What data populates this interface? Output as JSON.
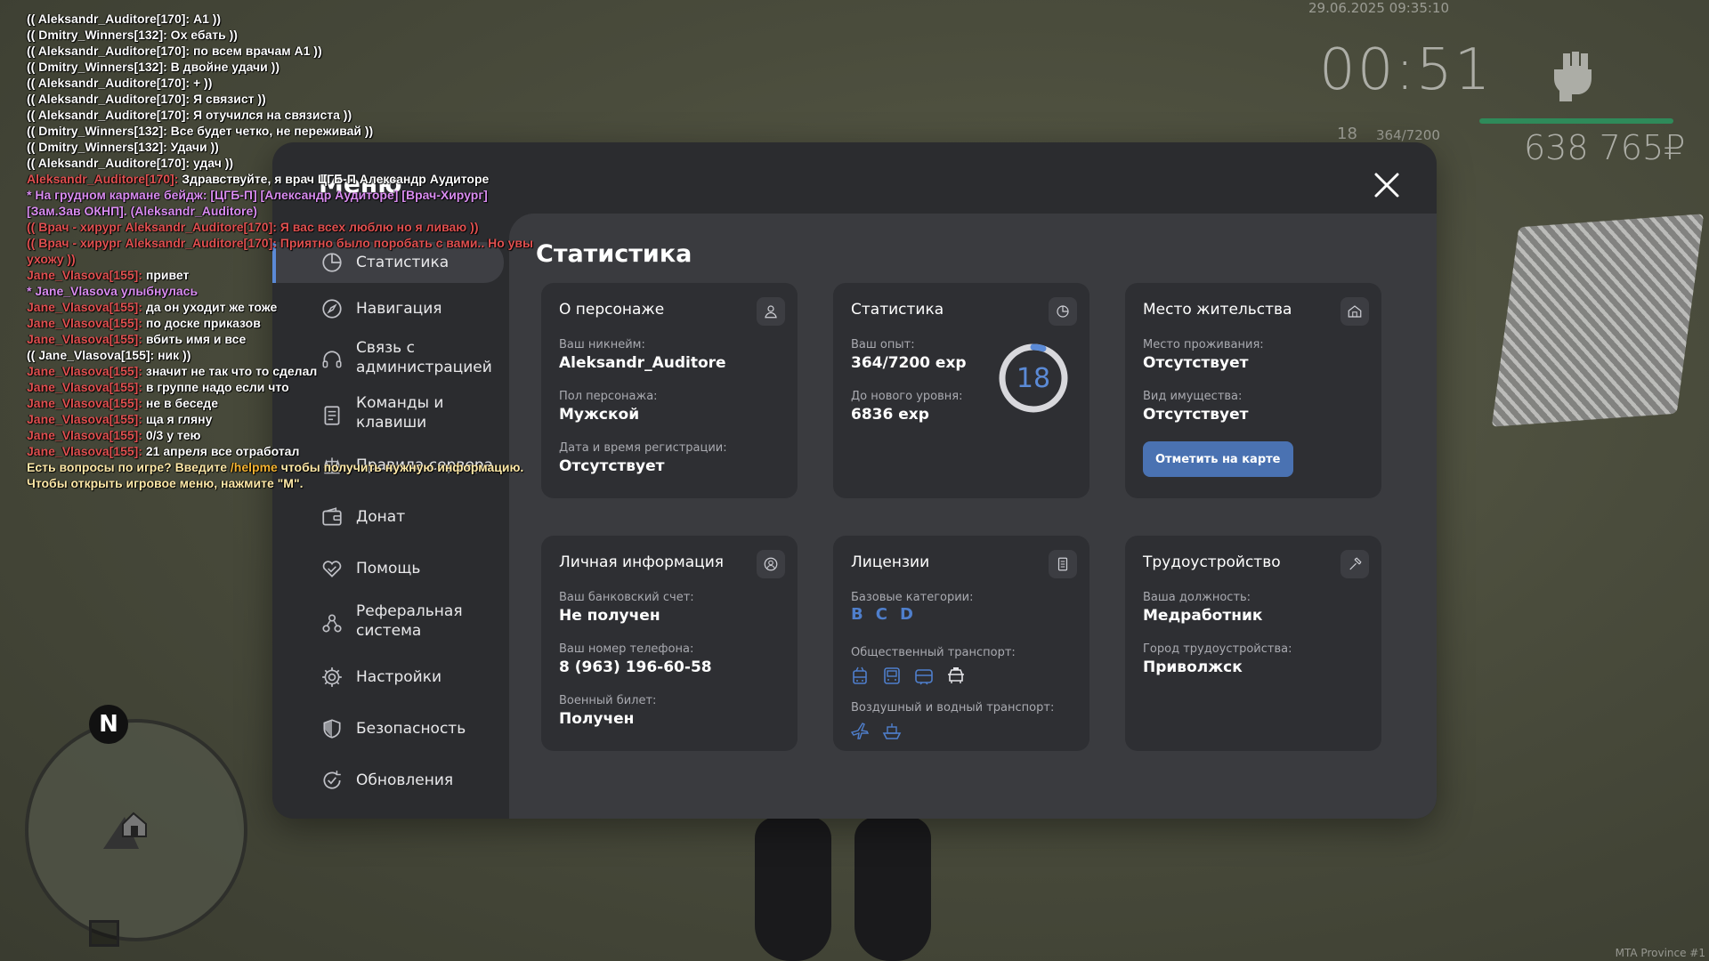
{
  "hud": {
    "datetime": "29.06.2025 09:35:10",
    "clock": "00:51",
    "level": "18",
    "exp": "364/7200",
    "money": "638 765₽",
    "server": "MTA Province #1",
    "fist_icon": "fist-icon",
    "exp_bar_color": "#2f8a5a"
  },
  "minimap": {
    "north_label": "N"
  },
  "chat": [
    {
      "parts": [
        {
          "c": "white",
          "t": "(( Aleksandr_Auditore[170]: А1 ))"
        }
      ]
    },
    {
      "parts": [
        {
          "c": "white",
          "t": "(( Dmitry_Winners[132]: Ох ебать ))"
        }
      ]
    },
    {
      "parts": [
        {
          "c": "white",
          "t": "(( Aleksandr_Auditore[170]: по всем врачам А1 ))"
        }
      ]
    },
    {
      "parts": [
        {
          "c": "white",
          "t": "(( Dmitry_Winners[132]: В двойне удачи ))"
        }
      ]
    },
    {
      "parts": [
        {
          "c": "white",
          "t": "(( Aleksandr_Auditore[170]: + ))"
        }
      ]
    },
    {
      "parts": [
        {
          "c": "white",
          "t": "(( Aleksandr_Auditore[170]: Я связист ))"
        }
      ]
    },
    {
      "parts": [
        {
          "c": "white",
          "t": "(( Aleksandr_Auditore[170]: Я отучился на связиста ))"
        }
      ]
    },
    {
      "parts": [
        {
          "c": "white",
          "t": "(( Dmitry_Winners[132]: Все будет четко, не переживай ))"
        }
      ]
    },
    {
      "parts": [
        {
          "c": "white",
          "t": "(( Dmitry_Winners[132]: Удачи ))"
        }
      ]
    },
    {
      "parts": [
        {
          "c": "white",
          "t": "(( Aleksandr_Auditore[170]: удач ))"
        }
      ]
    },
    {
      "parts": [
        {
          "c": "red",
          "t": "Aleksandr_Auditore[170]: "
        },
        {
          "c": "white",
          "t": "Здравствуйте, я врач ЦГБ-П Александр Аудиторе"
        }
      ]
    },
    {
      "parts": [
        {
          "c": "purple",
          "t": "* На грудном кармане бейдж: [ЦГБ-П] [Александр Аудиторе] [Врач-Хирург] [Зам.Зав ОКНП]. (Aleksandr_Auditore)"
        }
      ],
      "wrap": true
    },
    {
      "parts": [
        {
          "c": "red",
          "t": "(( Врач - хирург Aleksandr_Auditore[170]: Я вас всех люблю но я ливаю ))"
        }
      ]
    },
    {
      "parts": [
        {
          "c": "red",
          "t": "(( Врач - хирург Aleksandr_Auditore[170]: Приятно было поробать с вами.. Но увы ухожу ))"
        }
      ],
      "wrap": true
    },
    {
      "parts": [
        {
          "c": "red",
          "t": "Jane_Vlasova[155]: "
        },
        {
          "c": "white",
          "t": "привет"
        }
      ]
    },
    {
      "parts": [
        {
          "c": "purple",
          "t": "* Jane_Vlasova улыбнулась"
        }
      ]
    },
    {
      "parts": [
        {
          "c": "red",
          "t": "Jane_Vlasova[155]: "
        },
        {
          "c": "white",
          "t": "да он уходит же тоже"
        }
      ]
    },
    {
      "parts": [
        {
          "c": "red",
          "t": "Jane_Vlasova[155]: "
        },
        {
          "c": "white",
          "t": "по доске приказов"
        }
      ]
    },
    {
      "parts": [
        {
          "c": "red",
          "t": "Jane_Vlasova[155]: "
        },
        {
          "c": "white",
          "t": "вбить имя и все"
        }
      ]
    },
    {
      "parts": [
        {
          "c": "white",
          "t": "(( Jane_Vlasova[155]: ник ))"
        }
      ]
    },
    {
      "parts": [
        {
          "c": "red",
          "t": "Jane_Vlasova[155]: "
        },
        {
          "c": "white",
          "t": "значит не так что то сделал"
        }
      ]
    },
    {
      "parts": [
        {
          "c": "red",
          "t": "Jane_Vlasova[155]: "
        },
        {
          "c": "white",
          "t": "в группе надо если что"
        }
      ]
    },
    {
      "parts": [
        {
          "c": "red",
          "t": "Jane_Vlasova[155]: "
        },
        {
          "c": "white",
          "t": "не в беседе"
        }
      ]
    },
    {
      "parts": [
        {
          "c": "red",
          "t": "Jane_Vlasova[155]: "
        },
        {
          "c": "white",
          "t": "ща я гляну"
        }
      ]
    },
    {
      "parts": [
        {
          "c": "red",
          "t": "Jane_Vlasova[155]: "
        },
        {
          "c": "white",
          "t": "0/3 у тею"
        }
      ]
    },
    {
      "parts": [
        {
          "c": "red",
          "t": "Jane_Vlasova[155]: "
        },
        {
          "c": "white",
          "t": "21 апреля все отработал"
        }
      ]
    },
    {
      "parts": [
        {
          "c": "yellow",
          "t": "Есть вопросы по игре? Введите "
        },
        {
          "c": "orange",
          "t": "/helpme"
        },
        {
          "c": "yellow",
          "t": " чтобы получить нужную информацию."
        }
      ],
      "wrap": true
    },
    {
      "parts": [
        {
          "c": "yellow",
          "t": "Чтобы открыть игровое меню, нажмите \"M\"."
        }
      ]
    }
  ],
  "menu": {
    "title": "Меню",
    "close_icon": "close-icon",
    "sidebar": [
      {
        "label": "Статистика",
        "icon": "pie-chart-icon",
        "active": true
      },
      {
        "label": "Навигация",
        "icon": "compass-icon"
      },
      {
        "label": "Связь с администрацией",
        "icon": "headset-icon"
      },
      {
        "label": "Команды и клавиши",
        "icon": "document-icon"
      },
      {
        "label": "Правила сервера",
        "icon": "rules-icon"
      },
      {
        "label": "Донат",
        "icon": "wallet-icon"
      },
      {
        "label": "Помощь",
        "icon": "handshake-heart-icon"
      },
      {
        "label": "Реферальная система",
        "icon": "referral-icon"
      },
      {
        "label": "Настройки",
        "icon": "gear-icon"
      },
      {
        "label": "Безопасность",
        "icon": "shield-icon"
      },
      {
        "label": "Обновления",
        "icon": "refresh-check-icon"
      }
    ],
    "accent_color": "#5b8ad6"
  },
  "stats": {
    "title": "Статистика",
    "character": {
      "title": "О персонаже",
      "icon": "user-icon",
      "nickname_label": "Ваш никнейм:",
      "nickname": "Aleksandr_Auditore",
      "gender_label": "Пол персонажа:",
      "gender": "Мужской",
      "reg_label": "Дата и время регистрации:",
      "reg": "Отсутствует"
    },
    "statistics": {
      "title": "Статистика",
      "icon": "pie-chart-icon",
      "exp_label": "Ваш опыт:",
      "exp": "364/7200 exp",
      "next_label": "До нового уровня:",
      "next": "6836 exp",
      "level": "18",
      "progress": 0.0506
    },
    "residence": {
      "title": "Место жительства",
      "icon": "house-icon",
      "place_label": "Место проживания:",
      "place": "Отсутствует",
      "property_label": "Вид имущества:",
      "property": "Отсутствует",
      "button": "Отметить на карте"
    },
    "personal": {
      "title": "Личная информация",
      "icon": "user-circle-icon",
      "bank_label": "Ваш банковский счет:",
      "bank": "Не получен",
      "phone_label": "Ваш номер телефона:",
      "phone": "8 (963) 196-60-58",
      "military_label": "Военный билет:",
      "military": "Получен"
    },
    "licenses": {
      "title": "Лицензии",
      "icon": "license-icon",
      "base_label": "Базовые категории:",
      "categories": [
        "B",
        "C",
        "D"
      ],
      "public_label": "Общественный транспорт:",
      "public_icons": [
        "trolleybus-icon",
        "bus-icon",
        "tram-icon",
        "taxi-icon"
      ],
      "air_label": "Воздушный и водный транспорт:",
      "air_icons": [
        "plane-icon",
        "boat-icon"
      ]
    },
    "employment": {
      "title": "Трудоустройство",
      "icon": "hammer-icon",
      "position_label": "Ваша должность:",
      "position": "Медработник",
      "city_label": "Город трудоустройства:",
      "city": "Приволжск"
    }
  }
}
